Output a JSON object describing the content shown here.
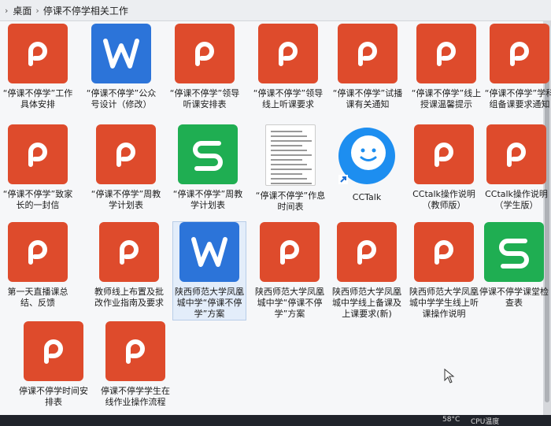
{
  "breadcrumb": {
    "root": "桌面",
    "folder": "停课不停学相关工作"
  },
  "colors": {
    "ppt": "#de4b2c",
    "doc": "#2c74d9",
    "xls": "#1fae52"
  },
  "files": [
    {
      "label": "“停课不停学”工作具体安排",
      "type": "ppt"
    },
    {
      "label": "“停课不停学”公众号设计（修改）",
      "type": "doc"
    },
    {
      "label": "“停课不停学”领导听课安排表",
      "type": "ppt"
    },
    {
      "label": "“停课不停学”领导线上听课要求",
      "type": "ppt"
    },
    {
      "label": "“停课不停学”试播课有关通知",
      "type": "ppt"
    },
    {
      "label": "“停课不停学”线上授课温馨提示",
      "type": "ppt"
    },
    {
      "label": "“停课不停学”学科组备课要求通知",
      "type": "ppt"
    },
    {
      "label": "“停课不停学”致家长的一封信",
      "type": "ppt"
    },
    {
      "label": "“停课不停学”周教学计划表",
      "type": "ppt"
    },
    {
      "label": "“停课不停学”周教学计划表",
      "type": "xls"
    },
    {
      "label": "“停课不停学”作息时间表",
      "type": "img"
    },
    {
      "label": "CCTalk",
      "type": "cc"
    },
    {
      "label": "CCtalk操作说明（教师版）",
      "type": "ppt"
    },
    {
      "label": "CCtalk操作说明（学生版）",
      "type": "ppt"
    },
    {
      "label": "第一天直播课总结、反馈",
      "type": "ppt"
    },
    {
      "label": "教师线上布置及批改作业指南及要求",
      "type": "ppt"
    },
    {
      "label": "陕西师范大学凤凰城中学“停课不停学”方案",
      "type": "doc"
    },
    {
      "label": "陕西师范大学凤凰城中学“停课不停学”方案",
      "type": "ppt"
    },
    {
      "label": "陕西师范大学凤凰城中学线上备课及上课要求(新)",
      "type": "ppt"
    },
    {
      "label": "陕西师范大学凤凰城中学学生线上听课操作说明",
      "type": "ppt"
    },
    {
      "label": "停课不停学课堂检查表",
      "type": "xls"
    },
    {
      "label": "停课不停学时间安排表",
      "type": "ppt"
    },
    {
      "label": "停课不停学学生在线作业操作流程",
      "type": "ppt"
    }
  ],
  "taskbar": {
    "temp": "58°C",
    "status": "CPU温度"
  }
}
